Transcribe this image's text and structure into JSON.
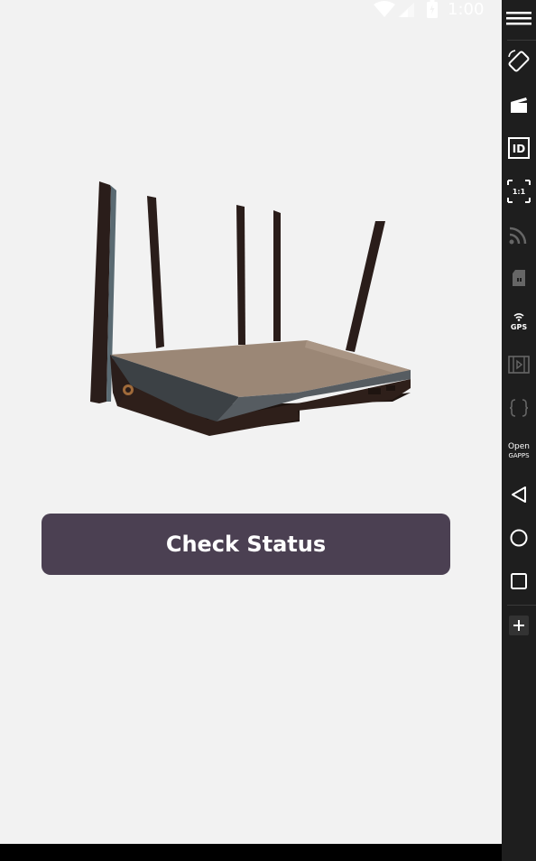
{
  "status_bar": {
    "time": "1:00",
    "icons": [
      "wifi-icon",
      "signal-icon",
      "battery-icon"
    ]
  },
  "main": {
    "illustration": "router-illustration",
    "check_status_label": "Check Status"
  },
  "colors": {
    "background": "#f2f2f2",
    "button": "#4b4052",
    "button_text": "#ffffff",
    "toolbar": "#1e1e1e"
  },
  "emulator_toolbar": {
    "items": [
      {
        "icon": "menu-icon"
      },
      {
        "icon": "rotate-icon"
      },
      {
        "icon": "screen-record-icon"
      },
      {
        "icon": "device-id-icon",
        "label": "ID"
      },
      {
        "icon": "pixel-perfect-icon",
        "label": "1:1"
      },
      {
        "icon": "network-icon"
      },
      {
        "icon": "sd-card-icon"
      },
      {
        "icon": "gps-icon",
        "label": "GPS"
      },
      {
        "icon": "media-icon"
      },
      {
        "icon": "javascript-icon"
      },
      {
        "icon": "open-gapps-icon",
        "label_line1": "Open",
        "label_line2": "GAPPS"
      },
      {
        "icon": "back-icon"
      },
      {
        "icon": "home-icon"
      },
      {
        "icon": "recents-icon"
      },
      {
        "icon": "add-icon"
      }
    ],
    "id_label": "ID",
    "ratio_label": "1:1",
    "gps_label": "GPS",
    "gapps_line1": "Open",
    "gapps_line2": "GAPPS"
  }
}
